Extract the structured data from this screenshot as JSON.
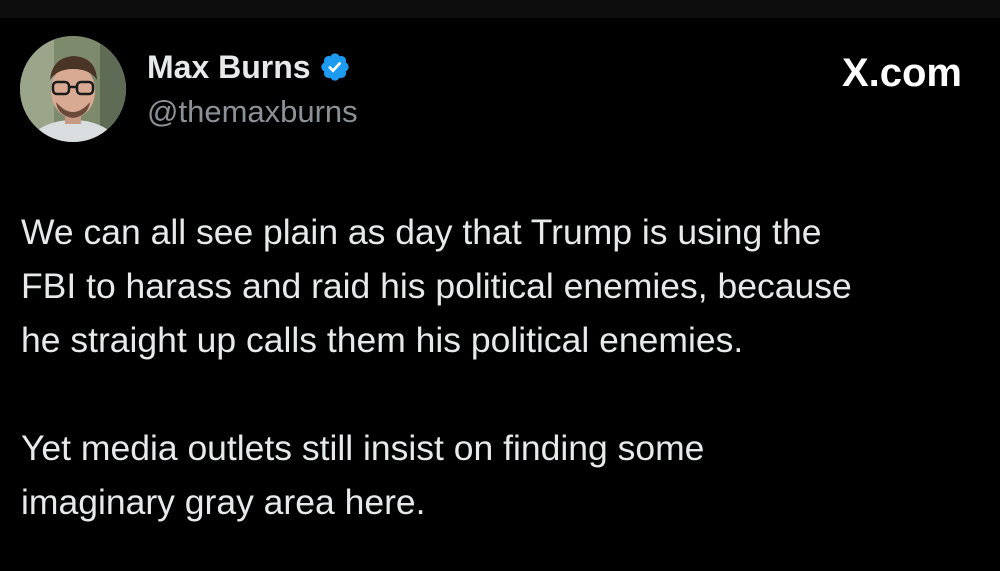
{
  "author": {
    "display_name": "Max Burns",
    "handle": "@themaxburns",
    "verified": true,
    "verified_icon": "verified-badge-icon",
    "verified_color": "#1d9bf0"
  },
  "brand": {
    "text": "X.com"
  },
  "tweet": {
    "paragraph_1": [
      "We can all see plain as day that Trump is using the",
      "FBI to harass and raid his political enemies, because",
      "he straight up calls them his political enemies."
    ],
    "paragraph_2": [
      "Yet media outlets still insist on finding some",
      "imaginary gray area here."
    ]
  },
  "colors": {
    "background": "#000000",
    "text_primary": "#e7e9ea",
    "text_secondary": "#8b9196"
  }
}
